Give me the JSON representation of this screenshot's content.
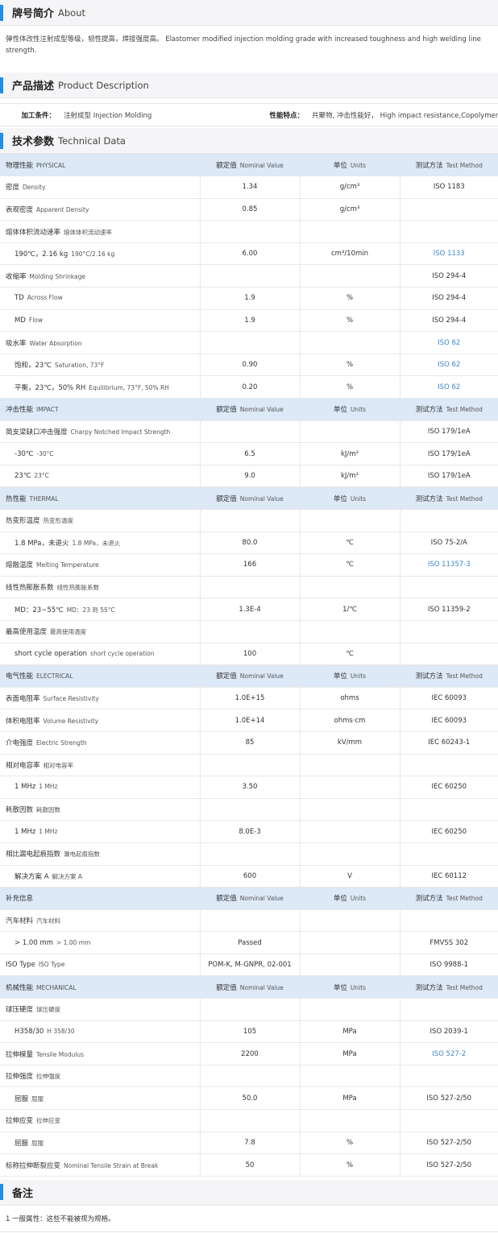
{
  "about": {
    "cn": "牌号简介",
    "en": "About",
    "text": "弹性体改性注射成型等级，韧性提高，焊接强度高。  Elastomer modified injection molding grade with increased toughness and high welding line strength."
  },
  "product": {
    "cn": "产品描述",
    "en": "Product Description",
    "label1": "加工条件：",
    "value1": "注射成型  Injection Molding",
    "label2": "性能特点：",
    "value2": "共聚物, 冲击性能好，  High impact resistance,Copolymer"
  },
  "tech": {
    "cn": "技术参数",
    "en": "Technical Data"
  },
  "header": {
    "nominal_cn": "额定值",
    "nominal_en": "Nominal Value",
    "units_cn": "单位",
    "units_en": "Units",
    "method_cn": "测试方法",
    "method_en": "Test Method"
  },
  "rows": [
    {
      "h": 1,
      "cn": "物理性能",
      "en": "PHYSICAL"
    },
    {
      "cn": "密度",
      "en": "Density",
      "v": "1.34",
      "u": "g/cm³",
      "m": "ISO 1183"
    },
    {
      "cn": "表观密度",
      "en": "Apparent Density",
      "v": "0.85",
      "u": "g/cm³",
      "m": ""
    },
    {
      "cn": "熔体体积流动速率",
      "en": "熔体体积流动速率",
      "v": "",
      "u": "",
      "m": ""
    },
    {
      "i": 1,
      "cn": "190℃，2.16 kg",
      "en": "190°C/2.16 kg",
      "v": "6.00",
      "u": "cm³/10min",
      "m": "ISO 1133",
      "l": 1
    },
    {
      "cn": "收缩率",
      "en": "Molding Shrinkage",
      "v": "",
      "u": "",
      "m": "ISO 294-4"
    },
    {
      "i": 1,
      "cn": "TD",
      "en": "Across Flow",
      "v": "1.9",
      "u": "%",
      "m": "ISO 294-4"
    },
    {
      "i": 1,
      "cn": "MD",
      "en": "Flow",
      "v": "1.9",
      "u": "%",
      "m": "ISO 294-4"
    },
    {
      "cn": "吸水率",
      "en": "Water Absorption",
      "v": "",
      "u": "",
      "m": "ISO 62",
      "l": 1
    },
    {
      "i": 1,
      "cn": "饱和，23℃",
      "en": "Saturation, 73°F",
      "v": "0.90",
      "u": "%",
      "m": "ISO 62",
      "l": 1
    },
    {
      "i": 1,
      "cn": "平衡，23℃，50% RH",
      "en": "Equilibrium, 73°F, 50% RH",
      "v": "0.20",
      "u": "%",
      "m": "ISO 62",
      "l": 1
    },
    {
      "h": 1,
      "cn": "冲击性能",
      "en": "IMPACT"
    },
    {
      "cn": "简支梁缺口冲击强度",
      "en": "Charpy Notched Impact Strength",
      "v": "",
      "u": "",
      "m": "ISO 179/1eA"
    },
    {
      "i": 1,
      "cn": "-30℃",
      "en": "-30°C",
      "v": "6.5",
      "u": "kJ/m²",
      "m": "ISO 179/1eA"
    },
    {
      "i": 1,
      "cn": "23℃",
      "en": "23°C",
      "v": "9.0",
      "u": "kJ/m²",
      "m": "ISO 179/1eA"
    },
    {
      "h": 1,
      "cn": "热性能",
      "en": "THERMAL"
    },
    {
      "cn": "热变形温度",
      "en": "热变形温度",
      "v": "",
      "u": "",
      "m": ""
    },
    {
      "i": 1,
      "cn": "1.8 MPa，未退火",
      "en": "1.8 MPa，未退火",
      "v": "80.0",
      "u": "℃",
      "m": "ISO 75-2/A"
    },
    {
      "cn": "熔融温度",
      "en": "Melting Temperature",
      "v": "166",
      "u": "℃",
      "m": "ISO 11357-3",
      "l": 1
    },
    {
      "cn": "线性热膨胀系数",
      "en": "线性热膨胀系数",
      "v": "",
      "u": "",
      "m": ""
    },
    {
      "i": 1,
      "cn": "MD：23~55℃",
      "en": "MD：23 到 55°C",
      "v": "1.3E-4",
      "u": "1/℃",
      "m": "ISO 11359-2"
    },
    {
      "cn": "最高使用温度",
      "en": "最高使用温度",
      "v": "",
      "u": "",
      "m": ""
    },
    {
      "i": 1,
      "cn": "short cycle operation",
      "en": "short cycle operation",
      "v": "100",
      "u": "℃",
      "m": ""
    },
    {
      "h": 1,
      "cn": "电气性能",
      "en": "ELECTRICAL"
    },
    {
      "cn": "表面电阻率",
      "en": "Surface Resistivity",
      "v": "1.0E+15",
      "u": "ohms",
      "m": "IEC 60093"
    },
    {
      "cn": "体积电阻率",
      "en": "Volume Resistivity",
      "v": "1.0E+14",
      "u": "ohms·cm",
      "m": "IEC 60093"
    },
    {
      "cn": "介电强度",
      "en": "Electric Strength",
      "v": "85",
      "u": "kV/mm",
      "m": "IEC 60243-1"
    },
    {
      "cn": "相对电容率",
      "en": "相对电容率",
      "v": "",
      "u": "",
      "m": ""
    },
    {
      "i": 1,
      "cn": "1 MHz",
      "en": "1 MHz",
      "v": "3.50",
      "u": "",
      "m": "IEC 60250"
    },
    {
      "cn": "耗散因数",
      "en": "耗散因数",
      "v": "",
      "u": "",
      "m": ""
    },
    {
      "i": 1,
      "cn": "1 MHz",
      "en": "1 MHz",
      "v": "8.0E-3",
      "u": "",
      "m": "IEC 60250"
    },
    {
      "cn": "相比漏电起痕指数",
      "en": "漏电起痕指数",
      "v": "",
      "u": "",
      "m": ""
    },
    {
      "i": 1,
      "cn": "解决方案 A",
      "en": "解决方案 A",
      "v": "600",
      "u": "V",
      "m": "IEC 60112"
    },
    {
      "h": 1,
      "cn": "补充信息",
      "en": ""
    },
    {
      "cn": "汽车材料",
      "en": "汽车材料",
      "v": "",
      "u": "",
      "m": ""
    },
    {
      "i": 1,
      "cn": "> 1.00 mm",
      "en": "> 1.00 mm",
      "v": "Passed",
      "u": "",
      "m": "FMVSS 302"
    },
    {
      "cn": "ISO Type",
      "en": "ISO Type",
      "v": "POM-K, M-GNPR, 02-001",
      "u": "",
      "m": "ISO 9988-1"
    },
    {
      "h": 1,
      "cn": "机械性能",
      "en": "MECHANICAL"
    },
    {
      "cn": "球压硬度",
      "en": "球压硬度",
      "v": "",
      "u": "",
      "m": ""
    },
    {
      "i": 1,
      "cn": "H358/30",
      "en": "H 358/30",
      "v": "105",
      "u": "MPa",
      "m": "ISO 2039-1"
    },
    {
      "cn": "拉伸模量",
      "en": "Tensile Modulus",
      "v": "2200",
      "u": "MPa",
      "m": "ISO 527-2",
      "l": 1
    },
    {
      "cn": "拉伸强度",
      "en": "拉伸强度",
      "v": "",
      "u": "",
      "m": ""
    },
    {
      "i": 1,
      "cn": "屈服",
      "en": "屈服",
      "v": "50.0",
      "u": "MPa",
      "m": "ISO 527-2/50"
    },
    {
      "cn": "拉伸应变",
      "en": "拉伸应变",
      "v": "",
      "u": "",
      "m": ""
    },
    {
      "i": 1,
      "cn": "屈服",
      "en": "屈服",
      "v": "7.8",
      "u": "%",
      "m": "ISO 527-2/50"
    },
    {
      "cn": "标称拉伸断裂应变",
      "en": "Nominal Tensile Strain at Break",
      "v": "50",
      "u": "%",
      "m": "ISO 527-2/50"
    }
  ],
  "notes": {
    "cn": "备注",
    "text": "1 一般属性：这些不能被视为规格。"
  }
}
